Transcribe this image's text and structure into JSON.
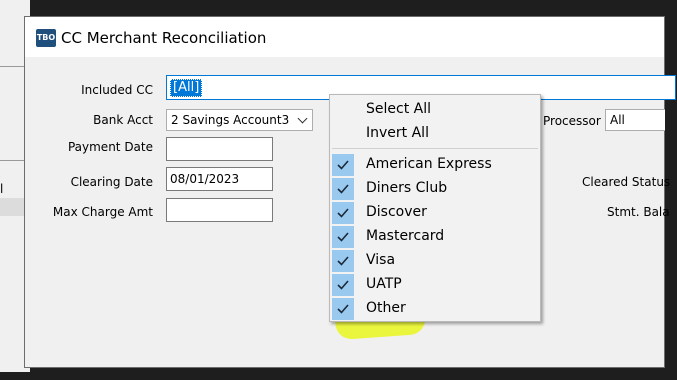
{
  "window": {
    "title": "CC Merchant Reconciliation",
    "icon_text": "TBO"
  },
  "background": {
    "left_text": "l",
    "right_stub": ""
  },
  "form": {
    "included_cc_label": "Included CC",
    "included_cc_value": "[All]",
    "bank_acct_label": "Bank Acct",
    "bank_acct_value": "2 Savings Account3",
    "payment_date_label": "Payment Date",
    "payment_date_value": "",
    "clearing_date_label": "Clearing Date",
    "clearing_date_value": "08/01/2023",
    "max_charge_label": "Max Charge Amt",
    "max_charge_value": "",
    "processor_label": "Processor",
    "processor_value": "All",
    "cleared_status_label": "Cleared Status",
    "stmt_balance_label": "Stmt. Bala"
  },
  "dropdown": {
    "actions": [
      "Select All",
      "Invert All"
    ],
    "items": [
      {
        "label": "American Express",
        "checked": true
      },
      {
        "label": "Diners Club",
        "checked": true
      },
      {
        "label": "Discover",
        "checked": true
      },
      {
        "label": "Mastercard",
        "checked": true
      },
      {
        "label": "Visa",
        "checked": true
      },
      {
        "label": "UATP",
        "checked": true
      },
      {
        "label": "Other",
        "checked": true
      }
    ]
  },
  "colors": {
    "highlight": "#e9f71e",
    "check_bg": "#99c9ef",
    "selection": "#0078d7"
  }
}
